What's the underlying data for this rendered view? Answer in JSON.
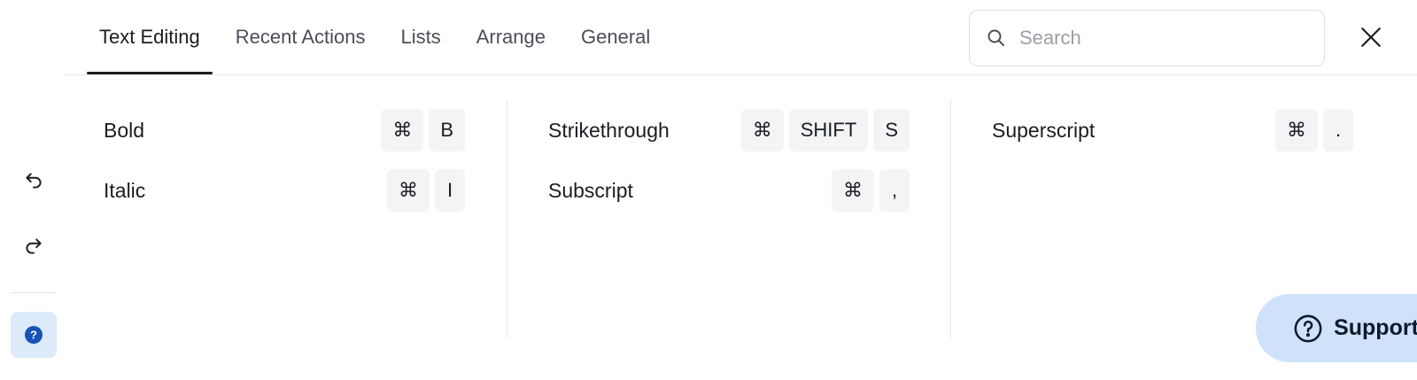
{
  "tabs": [
    {
      "label": "Text Editing",
      "active": true
    },
    {
      "label": "Recent Actions",
      "active": false
    },
    {
      "label": "Lists",
      "active": false
    },
    {
      "label": "Arrange",
      "active": false
    },
    {
      "label": "General",
      "active": false
    }
  ],
  "search": {
    "placeholder": "Search",
    "value": ""
  },
  "shortcuts": {
    "col1": [
      {
        "label": "Bold",
        "keys": [
          "⌘",
          "B"
        ]
      },
      {
        "label": "Italic",
        "keys": [
          "⌘",
          "I"
        ]
      }
    ],
    "col2": [
      {
        "label": "Strikethrough",
        "keys": [
          "⌘",
          "SHIFT",
          "S"
        ]
      },
      {
        "label": "Subscript",
        "keys": [
          "⌘",
          ","
        ]
      }
    ],
    "col3": [
      {
        "label": "Superscript",
        "keys": [
          "⌘",
          "."
        ]
      }
    ]
  },
  "support": {
    "label": "Support"
  },
  "icons": {
    "undo": "undo-icon",
    "redo": "redo-icon",
    "help": "help-icon",
    "search": "search-icon",
    "close": "close-icon",
    "support": "question-circle-icon"
  },
  "colors": {
    "accent": "#1a1d21",
    "help_bg": "#dceafa",
    "help_icon": "#1553b6",
    "support_bg": "#cfe2fa",
    "key_bg": "#f3f4f6"
  }
}
